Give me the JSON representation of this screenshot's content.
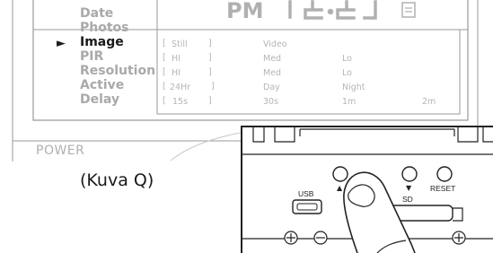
{
  "display": {
    "pm_label": "PM",
    "clock_digits": "12:23"
  },
  "menu": {
    "items": [
      {
        "label": "Date",
        "active": false
      },
      {
        "label": "Photos",
        "active": false
      },
      {
        "label": "Image",
        "active": true
      },
      {
        "label": "PIR",
        "active": false
      },
      {
        "label": "Resolution",
        "active": false
      },
      {
        "label": "Active",
        "active": false
      },
      {
        "label": "Delay",
        "active": false
      }
    ],
    "pointer": "►",
    "options": {
      "image": [
        "Still",
        "Video"
      ],
      "pir": [
        "HI",
        "Med",
        "Lo"
      ],
      "resolution": [
        "HI",
        "Med",
        "Lo"
      ],
      "active": [
        "24Hr",
        "Day",
        "Night"
      ],
      "delay": [
        "15s",
        "30s",
        "1m",
        "2m"
      ]
    }
  },
  "device": {
    "power_label": "POWER",
    "usb_label": "USB",
    "sd_label": "SD",
    "reset_label": "RESET",
    "up_arrow": "▲",
    "down_arrow": "▼"
  },
  "caption": "(Kuva Q)",
  "colors": {
    "text_dark": "#1a1a1a",
    "text_light": "#a9a9a9",
    "line": "#9a9a9a"
  }
}
